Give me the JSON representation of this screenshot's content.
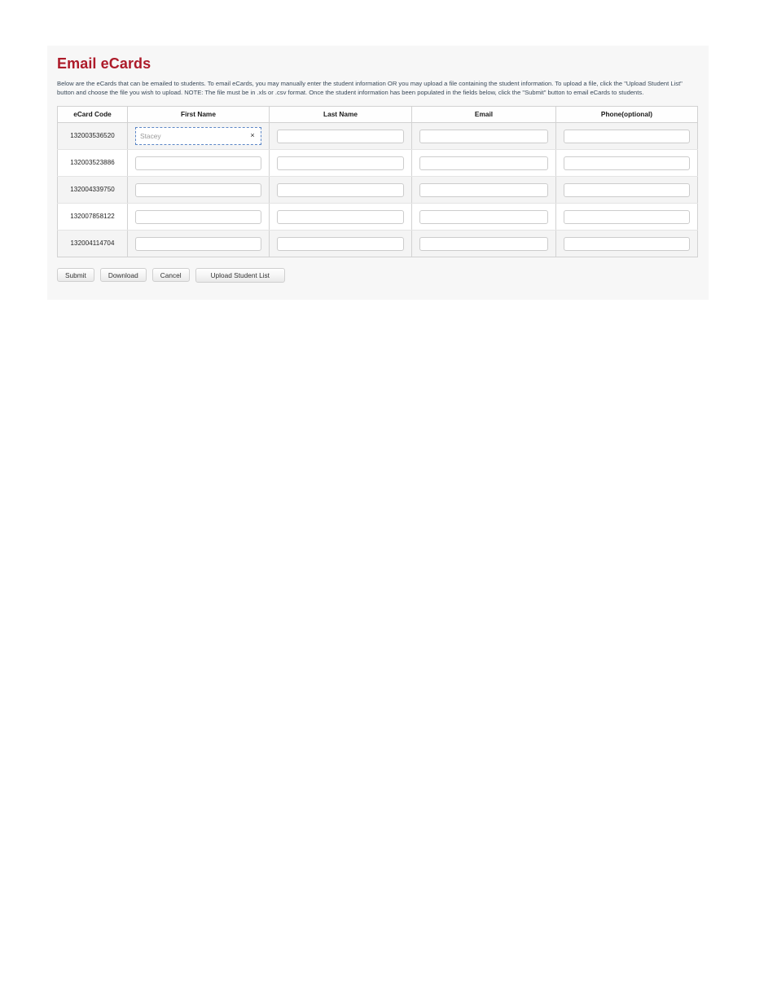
{
  "page": {
    "title": "Email eCards",
    "intro": "Below are the eCards that can be emailed to students. To email eCards, you may manually enter the student information OR you may upload a file containing the student information. To upload a file, click the \"Upload Student List\" button and choose the file you wish to upload. NOTE: The file must be in .xls or .csv format. Once the student information has been populated in the fields below, click the \"Submit\" button to email eCards to students.",
    "title_color": "#ad1b2a",
    "panel_bg": "#f7f7f7"
  },
  "table": {
    "headers": {
      "code": "eCard Code",
      "first_name": "First Name",
      "last_name": "Last Name",
      "email": "Email",
      "phone": "Phone(optional)"
    },
    "rows": [
      {
        "code": "132003536520",
        "first_name": "Stacey",
        "last_name": "",
        "email": "",
        "phone": "",
        "first_name_focused": true,
        "clear_icon": "×"
      },
      {
        "code": "132003523886",
        "first_name": "",
        "last_name": "",
        "email": "",
        "phone": "",
        "first_name_focused": false
      },
      {
        "code": "132004339750",
        "first_name": "",
        "last_name": "",
        "email": "",
        "phone": "",
        "first_name_focused": false
      },
      {
        "code": "132007858122",
        "first_name": "",
        "last_name": "",
        "email": "",
        "phone": "",
        "first_name_focused": false
      },
      {
        "code": "132004114704",
        "first_name": "",
        "last_name": "",
        "email": "",
        "phone": "",
        "first_name_focused": false
      }
    ]
  },
  "buttons": {
    "submit": "Submit",
    "download": "Download",
    "cancel": "Cancel",
    "upload": "Upload Student List"
  }
}
